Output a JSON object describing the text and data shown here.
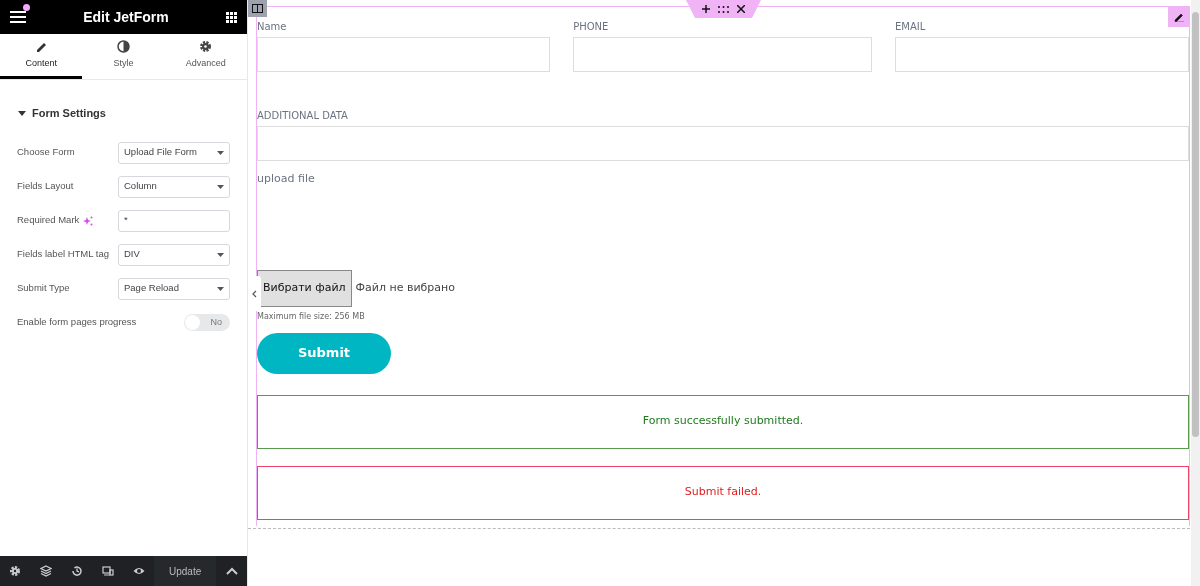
{
  "panel": {
    "title": "Edit JetForm",
    "tabs": [
      {
        "label": "Content",
        "selected": true
      },
      {
        "label": "Style",
        "selected": false
      },
      {
        "label": "Advanced",
        "selected": false
      }
    ],
    "section": {
      "title": "Form Settings",
      "expanded": true
    },
    "settings": [
      {
        "kind": "select",
        "label": "Choose Form",
        "value": "Upload File Form"
      },
      {
        "kind": "select",
        "label": "Fields Layout",
        "value": "Column"
      },
      {
        "kind": "input",
        "label": "Required Mark",
        "value": "*",
        "ai": true
      },
      {
        "kind": "select",
        "label": "Fields label HTML tag",
        "value": "DIV"
      },
      {
        "kind": "select",
        "label": "Submit Type",
        "value": "Page Reload"
      },
      {
        "kind": "switch",
        "label": "Enable form pages progress",
        "value": "No",
        "on": false
      }
    ],
    "footer": {
      "button": "Update"
    }
  },
  "form": {
    "rows": [
      [
        {
          "label": "Name"
        },
        {
          "label": "PHONE"
        },
        {
          "label": "EMAIL"
        }
      ],
      [
        {
          "label": "ADDITIONAL DATA"
        }
      ]
    ],
    "upload": {
      "label": "upload file",
      "button": "Вибрати файл",
      "status": "Файл не вибрано",
      "hint": "Maximum file size: 256 MB"
    },
    "submit": "Submit",
    "messages": [
      {
        "kind": "success",
        "text": "Form successfully submitted."
      },
      {
        "kind": "error",
        "text": "Submit failed."
      }
    ]
  }
}
